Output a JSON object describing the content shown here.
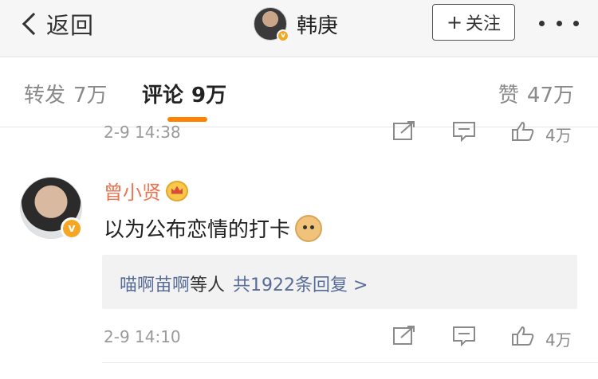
{
  "topbar": {
    "back_label": "返回",
    "title": "韩庚",
    "follow_label": "关注"
  },
  "tabs": {
    "repost": {
      "label": "转发",
      "count": "7万"
    },
    "comment": {
      "label": "评论",
      "count": "9万"
    },
    "like": {
      "label": "赞",
      "count": "47万"
    }
  },
  "previous_comment": {
    "time": "2-9 14:38",
    "like_count": "4万"
  },
  "comment": {
    "user": "曾小贤",
    "text": "以为公布恋情的打卡",
    "replies": {
      "names": "喵啊苗啊",
      "etc": "等人",
      "count_label": "共1922条回复 >"
    },
    "time": "2-9 14:10",
    "like_count": "4万"
  },
  "colors": {
    "accent_orange": "#ff8200",
    "username": "#eb7350",
    "reply_link": "#566b95",
    "verified_badge": "#f5a623"
  },
  "icons": [
    "back-chevron-icon",
    "verified-icon",
    "plus-icon",
    "more-icon",
    "share-icon",
    "reply-icon",
    "like-icon",
    "crown-badge-icon",
    "doge-emoji-icon"
  ]
}
